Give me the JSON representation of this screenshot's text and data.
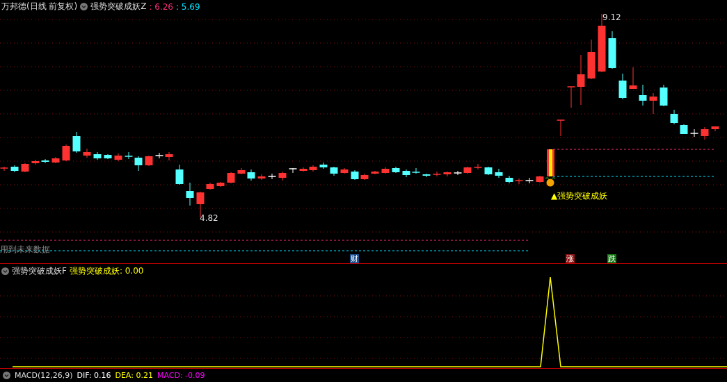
{
  "header": {
    "stock": "万邦德(日线 前复权)",
    "indicator": "强势突破成妖Z",
    "values": [
      {
        "text": ": 6.26",
        "color": "#ff2d7a"
      },
      {
        "text": ": 5.69",
        "color": "#00e5ff"
      }
    ]
  },
  "main_chart": {
    "high_label": "9.12",
    "low_label": "4.82",
    "signal_label": "▲强势突破成妖",
    "warning": "用到未来数据",
    "markers": [
      {
        "text": "财",
        "color": "#1d4f8c"
      },
      {
        "text": "涨",
        "color": "#8c1414"
      },
      {
        "text": "跌",
        "color": "#157a15"
      }
    ]
  },
  "lower_panel": {
    "indicator": "强势突破成妖F",
    "reading": "强势突破成妖: 0.00"
  },
  "bottom_panel": {
    "indicator": "MACD(12,26,9)",
    "readings": [
      {
        "text": "DIF: 0.16",
        "color": "#ffffff"
      },
      {
        "text": "DEA: 0.21",
        "color": "#ffff00"
      },
      {
        "text": "MACD: -0.09",
        "color": "#ff00ff"
      }
    ]
  }
}
